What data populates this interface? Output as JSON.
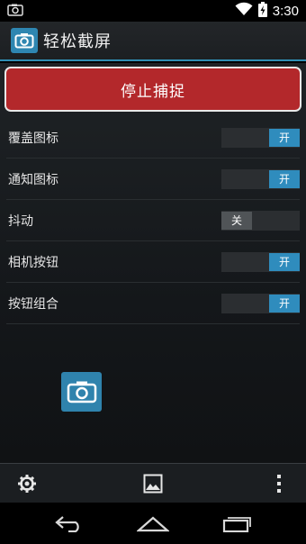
{
  "status_bar": {
    "time": "3:30"
  },
  "app": {
    "title": "轻松截屏"
  },
  "main": {
    "stop_button_label": "停止捕捉",
    "settings": [
      {
        "label": "覆盖图标",
        "state": "on",
        "toggle_text": "开"
      },
      {
        "label": "通知图标",
        "state": "on",
        "toggle_text": "开"
      },
      {
        "label": "抖动",
        "state": "off",
        "toggle_text": "关"
      },
      {
        "label": "相机按钮",
        "state": "on",
        "toggle_text": "开"
      },
      {
        "label": "按钮组合",
        "state": "on",
        "toggle_text": "开"
      }
    ]
  },
  "bottom_toolbar": {
    "icons": [
      "gear-icon",
      "image-icon",
      "overflow-menu-icon"
    ]
  },
  "nav_bar": {
    "icons": [
      "back-icon",
      "home-icon",
      "recent-apps-icon"
    ]
  },
  "colors": {
    "accent": "#2f8cbd",
    "stop_button": "#b3282b",
    "action_bar_divider": "#2f8fb5"
  }
}
